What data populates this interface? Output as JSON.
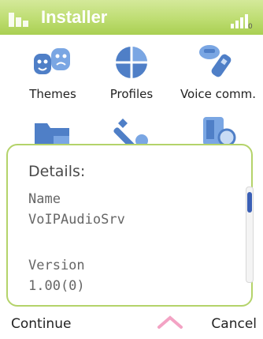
{
  "titlebar": {
    "title": "Installer"
  },
  "grid": {
    "items": [
      {
        "label": "Themes",
        "icon": "themes-icon"
      },
      {
        "label": "Profiles",
        "icon": "profiles-icon"
      },
      {
        "label": "Voice comm.",
        "icon": "voice-comm-icon"
      },
      {
        "label": "",
        "icon": "folder-icon"
      },
      {
        "label": "",
        "icon": "wrench-icon"
      },
      {
        "label": "",
        "icon": "app-icon"
      }
    ]
  },
  "dialog": {
    "heading": "Details:",
    "fields": [
      {
        "label": "Name",
        "value": "VoIPAudioSrv"
      },
      {
        "label": "Version",
        "value": "1.00(0)"
      }
    ],
    "scroll_position": 0.05
  },
  "softkeys": {
    "left": "Continue",
    "right": "Cancel"
  },
  "colors": {
    "titlebar": "#bedd72",
    "dialog_border": "#b4d36a",
    "scroll_thumb": "#3a5fb5"
  }
}
